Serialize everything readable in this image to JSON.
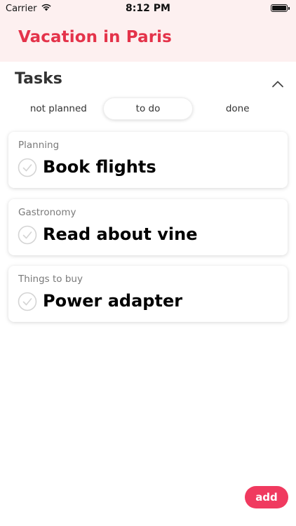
{
  "status_bar": {
    "carrier": "Carrier",
    "time": "8:12 PM"
  },
  "header": {
    "title": "Vacation in Paris",
    "title_color": "#e4334a",
    "background": "#fdf0f0"
  },
  "tasks_section": {
    "title": "Tasks",
    "collapse_icon": "chevron-up-icon",
    "filters": [
      {
        "label": "not planned",
        "selected": false
      },
      {
        "label": "to do",
        "selected": true
      },
      {
        "label": "done",
        "selected": false
      }
    ],
    "items": [
      {
        "category": "Planning",
        "name": "Book flights",
        "checked": false
      },
      {
        "category": "Gastronomy",
        "name": "Read about vine",
        "checked": false
      },
      {
        "category": "Things to buy",
        "name": "Power adapter",
        "checked": false
      }
    ]
  },
  "add_button": {
    "label": "add",
    "color": "#f03a5f"
  }
}
